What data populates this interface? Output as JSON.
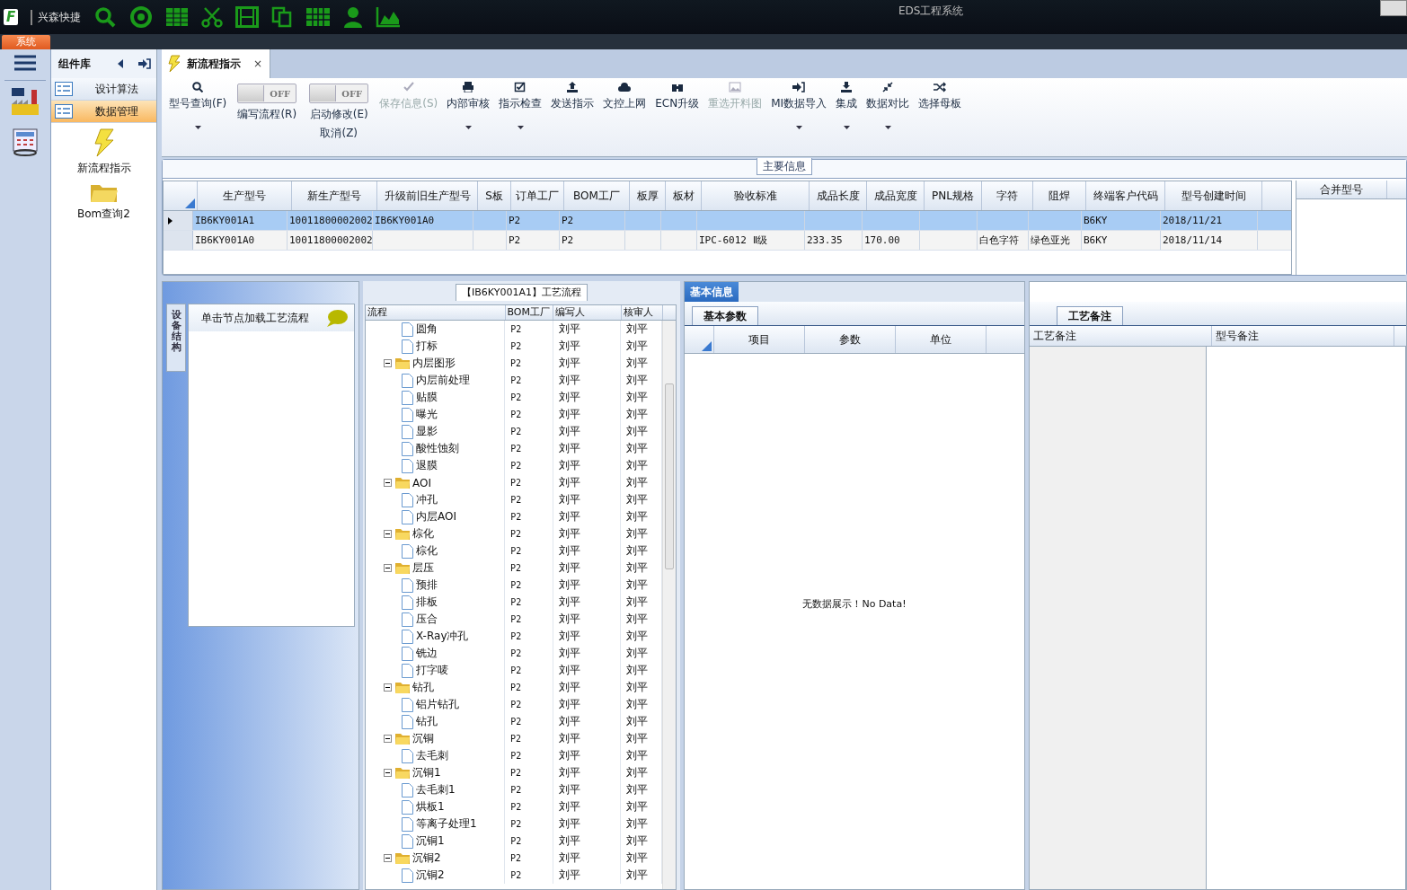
{
  "app": {
    "logo": "F",
    "name": "兴森快捷",
    "title": "EDS工程系统",
    "menu_tab": "系统"
  },
  "component_panel": {
    "title": "组件库",
    "groups": [
      {
        "label": "设计算法",
        "selected": false
      },
      {
        "label": "数据管理",
        "selected": true
      }
    ],
    "items": [
      {
        "label": "新流程指示"
      },
      {
        "label": "Bom查询2"
      }
    ]
  },
  "doc_tab": {
    "label": "新流程指示",
    "close": "×"
  },
  "toolbar": [
    {
      "kind": "button",
      "label": "型号查询(F)",
      "disabled": false,
      "dropdown": true
    },
    {
      "kind": "toggle",
      "label": "编写流程(R)",
      "on": false,
      "state": "OFF"
    },
    {
      "kind": "toggle",
      "label": "启动修改(E)",
      "label2": "取消(Z)",
      "on": false,
      "state": "OFF"
    },
    {
      "kind": "button",
      "label": "保存信息(S)",
      "disabled": true,
      "dropdown": false
    },
    {
      "kind": "button",
      "label": "内部审核",
      "disabled": false,
      "dropdown": true
    },
    {
      "kind": "button",
      "label": "指示检查",
      "disabled": false,
      "dropdown": true
    },
    {
      "kind": "button",
      "label": "发送指示",
      "disabled": false,
      "dropdown": false
    },
    {
      "kind": "button",
      "label": "文控上网",
      "disabled": false,
      "dropdown": false
    },
    {
      "kind": "button",
      "label": "ECN升级",
      "disabled": false,
      "dropdown": false
    },
    {
      "kind": "button",
      "label": "重选开料图",
      "disabled": true,
      "dropdown": false
    },
    {
      "kind": "button",
      "label": "MI数据导入",
      "disabled": false,
      "dropdown": true
    },
    {
      "kind": "button",
      "label": "集成",
      "disabled": false,
      "dropdown": true
    },
    {
      "kind": "button",
      "label": "数据对比",
      "disabled": false,
      "dropdown": true
    },
    {
      "kind": "button",
      "label": "选择母板",
      "disabled": false,
      "dropdown": false
    }
  ],
  "main_info": {
    "title": "主要信息",
    "columns": [
      "生产型号",
      "新生产型号",
      "升级前旧生产型号",
      "S板",
      "订单工厂",
      "BOM工厂",
      "板厚",
      "板材",
      "验收标准",
      "成品长度",
      "成品宽度",
      "PNL规格",
      "字符",
      "阻焊",
      "终端客户代码",
      "型号创建时间"
    ],
    "rows": [
      {
        "selected": true,
        "cells": [
          "IB6KY001A1",
          "10011800002002",
          "IB6KY001A0",
          null,
          "P2",
          "P2",
          null,
          null,
          null,
          null,
          null,
          null,
          null,
          null,
          "B6KY",
          "2018/11/21"
        ]
      },
      {
        "selected": false,
        "cells": [
          "IB6KY001A0",
          "10011800002002",
          null,
          null,
          "P2",
          "P2",
          null,
          null,
          "IPC-6012 Ⅱ级",
          "233.35",
          "170.00",
          null,
          "白色字符",
          "绿色亚光",
          "B6KY",
          "2018/11/14"
        ]
      }
    ],
    "side_columns": [
      "合并型号"
    ]
  },
  "equipment_panel": {
    "side_tab": "设备结构",
    "hint": "单击节点加载工艺流程"
  },
  "process_tree": {
    "title": "【IB6KY001A1】工艺流程",
    "columns": [
      "流程",
      "BOM工厂",
      "编写人",
      "核审人"
    ],
    "nodes": [
      {
        "kind": "leaf",
        "label": "圆角",
        "factory": "P2",
        "writer": "刘平",
        "reviewer": "刘平"
      },
      {
        "kind": "leaf",
        "label": "打标",
        "factory": "P2",
        "writer": "刘平",
        "reviewer": "刘平"
      },
      {
        "kind": "folder",
        "label": "内层图形",
        "factory": "P2",
        "writer": "刘平",
        "reviewer": "刘平",
        "expanded": true,
        "children": [
          {
            "kind": "leaf",
            "label": "内层前处理",
            "factory": "P2",
            "writer": "刘平",
            "reviewer": "刘平"
          },
          {
            "kind": "leaf",
            "label": "贴膜",
            "factory": "P2",
            "writer": "刘平",
            "reviewer": "刘平"
          },
          {
            "kind": "leaf",
            "label": "曝光",
            "factory": "P2",
            "writer": "刘平",
            "reviewer": "刘平"
          },
          {
            "kind": "leaf",
            "label": "显影",
            "factory": "P2",
            "writer": "刘平",
            "reviewer": "刘平"
          },
          {
            "kind": "leaf",
            "label": "酸性蚀刻",
            "factory": "P2",
            "writer": "刘平",
            "reviewer": "刘平"
          },
          {
            "kind": "leaf",
            "label": "退膜",
            "factory": "P2",
            "writer": "刘平",
            "reviewer": "刘平"
          }
        ]
      },
      {
        "kind": "folder",
        "label": "AOI",
        "factory": "P2",
        "writer": "刘平",
        "reviewer": "刘平",
        "expanded": true,
        "children": [
          {
            "kind": "leaf",
            "label": "冲孔",
            "factory": "P2",
            "writer": "刘平",
            "reviewer": "刘平"
          },
          {
            "kind": "leaf",
            "label": "内层AOI",
            "factory": "P2",
            "writer": "刘平",
            "reviewer": "刘平"
          }
        ]
      },
      {
        "kind": "folder",
        "label": "棕化",
        "factory": "P2",
        "writer": "刘平",
        "reviewer": "刘平",
        "expanded": true,
        "children": [
          {
            "kind": "leaf",
            "label": "棕化",
            "factory": "P2",
            "writer": "刘平",
            "reviewer": "刘平"
          }
        ]
      },
      {
        "kind": "folder",
        "label": "层压",
        "factory": "P2",
        "writer": "刘平",
        "reviewer": "刘平",
        "expanded": true,
        "children": [
          {
            "kind": "leaf",
            "label": "预排",
            "factory": "P2",
            "writer": "刘平",
            "reviewer": "刘平"
          },
          {
            "kind": "leaf",
            "label": "排板",
            "factory": "P2",
            "writer": "刘平",
            "reviewer": "刘平"
          },
          {
            "kind": "leaf",
            "label": "压合",
            "factory": "P2",
            "writer": "刘平",
            "reviewer": "刘平"
          },
          {
            "kind": "leaf",
            "label": "X-Ray冲孔",
            "factory": "P2",
            "writer": "刘平",
            "reviewer": "刘平"
          },
          {
            "kind": "leaf",
            "label": "铣边",
            "factory": "P2",
            "writer": "刘平",
            "reviewer": "刘平"
          },
          {
            "kind": "leaf",
            "label": "打字唛",
            "factory": "P2",
            "writer": "刘平",
            "reviewer": "刘平"
          }
        ]
      },
      {
        "kind": "folder",
        "label": "钻孔",
        "factory": "P2",
        "writer": "刘平",
        "reviewer": "刘平",
        "expanded": true,
        "children": [
          {
            "kind": "leaf",
            "label": "铝片钻孔",
            "factory": "P2",
            "writer": "刘平",
            "reviewer": "刘平"
          },
          {
            "kind": "leaf",
            "label": "钻孔",
            "factory": "P2",
            "writer": "刘平",
            "reviewer": "刘平"
          }
        ]
      },
      {
        "kind": "folder",
        "label": "沉铜",
        "factory": "P2",
        "writer": "刘平",
        "reviewer": "刘平",
        "expanded": true,
        "children": [
          {
            "kind": "leaf",
            "label": "去毛刺",
            "factory": "P2",
            "writer": "刘平",
            "reviewer": "刘平"
          }
        ]
      },
      {
        "kind": "folder",
        "label": "沉铜1",
        "factory": "P2",
        "writer": "刘平",
        "reviewer": "刘平",
        "expanded": true,
        "children": [
          {
            "kind": "leaf",
            "label": "去毛刺1",
            "factory": "P2",
            "writer": "刘平",
            "reviewer": "刘平"
          },
          {
            "kind": "leaf",
            "label": "烘板1",
            "factory": "P2",
            "writer": "刘平",
            "reviewer": "刘平"
          },
          {
            "kind": "leaf",
            "label": "等离子处理1",
            "factory": "P2",
            "writer": "刘平",
            "reviewer": "刘平"
          },
          {
            "kind": "leaf",
            "label": "沉铜1",
            "factory": "P2",
            "writer": "刘平",
            "reviewer": "刘平"
          }
        ]
      },
      {
        "kind": "folder",
        "label": "沉铜2",
        "factory": "P2",
        "writer": "刘平",
        "reviewer": "刘平",
        "expanded": true,
        "children": [
          {
            "kind": "leaf",
            "label": "沉铜2",
            "factory": "P2",
            "writer": "刘平",
            "reviewer": "刘平"
          }
        ]
      }
    ]
  },
  "basic_info": {
    "tab": "基本信息",
    "subtab": "基本参数",
    "columns": [
      "项目",
      "参数",
      "单位"
    ],
    "empty": "无数据展示！No Data!"
  },
  "notes": {
    "subtab": "工艺备注",
    "columns": [
      "工艺备注",
      "型号备注"
    ]
  }
}
